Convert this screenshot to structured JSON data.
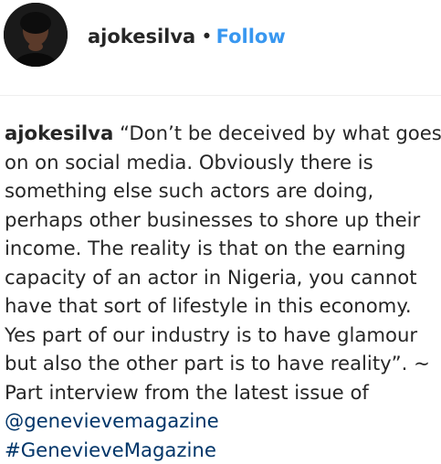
{
  "post": {
    "username": "ajokesilva",
    "separator": "•",
    "follow_label": "Follow"
  },
  "caption": {
    "author": "ajokesilva",
    "lines": [
      "“Don’t be deceived by what goes",
      "on on social media. Obviously there is",
      "something else such actors are doing,",
      "perhaps other businesses to shore up their",
      "income. The reality is that on the earning",
      "capacity of an actor in Nigeria, you cannot",
      "have that sort of lifestyle in this economy.",
      "Yes part of our industry is to have glamour",
      "but also the other part is to have reality”. ~",
      "Part interview from the latest issue of"
    ],
    "mention": "@genevievemagazine",
    "hashtag": "#GenevieveMagazine"
  },
  "colors": {
    "link": "#3897f0",
    "mention": "#003569",
    "text": "#262626"
  }
}
